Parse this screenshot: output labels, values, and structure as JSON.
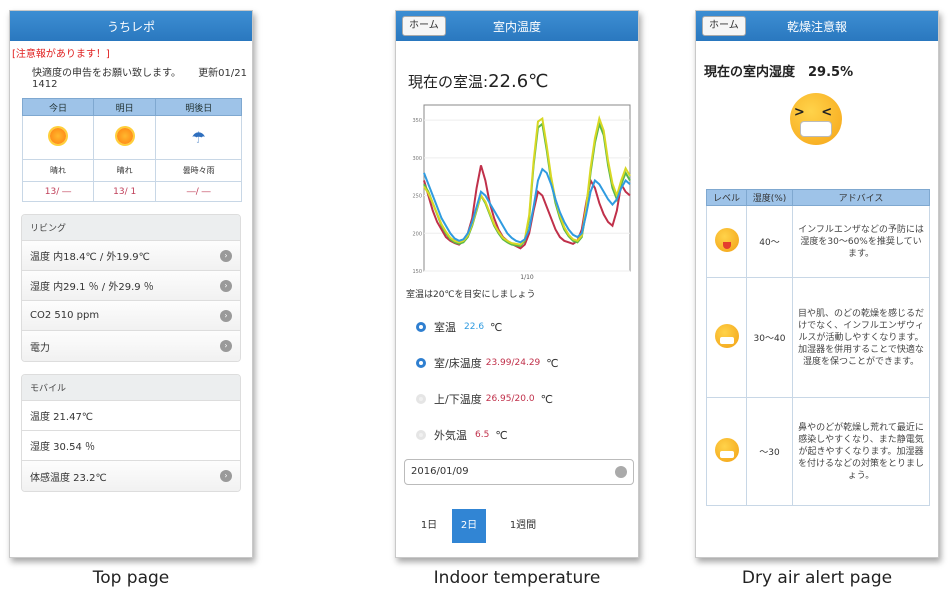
{
  "captions": [
    "Top page",
    "Indoor temperature",
    "Dry air alert page"
  ],
  "top": {
    "header": "うちレポ",
    "notice": "[注意報があります！]",
    "intro": "快適度の申告をお願い致します。",
    "updated": "更新01/21 1412",
    "forecast": {
      "days": [
        "今日",
        "明日",
        "明後日"
      ],
      "icons": [
        "sun-icon",
        "sun-icon",
        "cloud-umbrella-icon"
      ],
      "labels": [
        "晴れ",
        "晴れ",
        "曇時々雨"
      ],
      "temps": [
        "13/ ―",
        "13/ 1",
        "―/ ―"
      ]
    },
    "living": {
      "title": "リビング",
      "rows": [
        "温度 内18.4℃ / 外19.9℃",
        "湿度 内29.1 ％ / 外29.9 ％",
        "CO2  510  ppm",
        "電力"
      ]
    },
    "mobile": {
      "title": "モバイル",
      "rows": [
        "温度 21.47℃",
        "湿度 30.54 ％",
        "体感温度 23.2℃"
      ]
    }
  },
  "indoor": {
    "home": "ホーム",
    "header": "室内温度",
    "title_prefix": "現在の室温:",
    "title_value": "22.6℃",
    "advice": "室温は20℃を目安にしましょう",
    "sensors": [
      {
        "label": "室温",
        "value": "22.6",
        "unit": "℃",
        "on": true
      },
      {
        "label": "室/床温度",
        "value": "23.99/24.29",
        "unit": "℃",
        "on": true
      },
      {
        "label": "上/下温度",
        "value": "26.95/20.0",
        "unit": "℃",
        "on": false
      },
      {
        "label": "外気温",
        "value": "6.5",
        "unit": "℃",
        "on": false
      }
    ],
    "date": "2016/01/09",
    "ranges": [
      "1日",
      "2日",
      "1週間"
    ],
    "active_range": "2日",
    "colors": {
      "blue": "#2f9be0",
      "red": "#c0304a",
      "green": "#59b84a",
      "yellow": "#d8d824"
    }
  },
  "chart_data": {
    "type": "line",
    "x_tick": "1/10",
    "y_ticks": [
      "150",
      "200",
      "250",
      "300",
      "350"
    ],
    "ylim": [
      150,
      370
    ],
    "x": [
      0,
      1,
      2,
      3,
      4,
      5,
      6,
      7,
      8,
      9,
      10,
      11,
      12,
      13,
      14,
      15,
      16,
      17,
      18,
      19,
      20,
      21,
      22,
      23,
      24,
      25,
      26,
      27,
      28,
      29,
      30,
      31,
      32,
      33,
      34,
      35,
      36,
      37,
      38,
      39,
      40,
      41,
      42,
      43,
      44,
      45,
      46,
      47
    ],
    "series": [
      {
        "color": "#c0304a",
        "values": [
          270,
          250,
          230,
          215,
          205,
          195,
          190,
          187,
          185,
          190,
          200,
          220,
          260,
          290,
          270,
          240,
          220,
          205,
          195,
          190,
          186,
          183,
          180,
          185,
          200,
          230,
          255,
          250,
          235,
          220,
          205,
          195,
          190,
          188,
          186,
          190,
          205,
          240,
          270,
          260,
          240,
          225,
          215,
          210,
          230,
          265,
          255,
          250
        ]
      },
      {
        "color": "#59b84a",
        "values": [
          265,
          255,
          240,
          225,
          210,
          200,
          192,
          188,
          186,
          188,
          195,
          210,
          230,
          250,
          240,
          225,
          210,
          200,
          192,
          188,
          185,
          184,
          183,
          190,
          220,
          290,
          340,
          345,
          310,
          270,
          240,
          220,
          205,
          196,
          190,
          188,
          195,
          230,
          280,
          320,
          345,
          330,
          290,
          260,
          245,
          265,
          280,
          270
        ]
      },
      {
        "color": "#d8d824",
        "values": [
          262,
          253,
          240,
          226,
          212,
          202,
          194,
          190,
          188,
          190,
          197,
          212,
          232,
          250,
          242,
          227,
          212,
          202,
          194,
          190,
          187,
          186,
          185,
          192,
          224,
          295,
          348,
          352,
          316,
          275,
          244,
          224,
          208,
          198,
          192,
          190,
          197,
          234,
          286,
          326,
          352,
          336,
          296,
          266,
          250,
          270,
          286,
          276
        ]
      },
      {
        "color": "#2f9be0",
        "values": [
          280,
          265,
          250,
          235,
          220,
          210,
          200,
          193,
          190,
          192,
          200,
          215,
          235,
          255,
          250,
          240,
          230,
          220,
          210,
          200,
          194,
          190,
          188,
          192,
          205,
          235,
          270,
          285,
          280,
          265,
          245,
          228,
          215,
          205,
          198,
          195,
          200,
          225,
          255,
          270,
          265,
          255,
          245,
          238,
          245,
          260,
          270,
          265
        ]
      }
    ]
  },
  "dry": {
    "home": "ホーム",
    "header": "乾燥注意報",
    "title": "現在の室内湿度　29.5%",
    "face_eyes": "> <",
    "columns": [
      "レベル",
      "湿度(%)",
      "アドバイス"
    ],
    "rows": [
      {
        "icon": "happy-face-icon",
        "humidity": "40〜",
        "advice": "インフルエンザなどの予防には湿度を30〜60%を推奨しています。"
      },
      {
        "icon": "mask-face-icon",
        "humidity": "30〜40",
        "advice": "目や肌、のどの乾燥を感じるだけでなく、インフルエンザウィルスが活動しやすくなります。加湿器を併用することで快適な湿度を保つことができます。"
      },
      {
        "icon": "mask-face-sad-icon",
        "humidity": "〜30",
        "advice": "鼻やのどが乾燥し荒れて最近に感染しやすくなり、また静電気が起きやすくなります。加湿器を付けるなどの対策をとりましょう。"
      }
    ]
  }
}
